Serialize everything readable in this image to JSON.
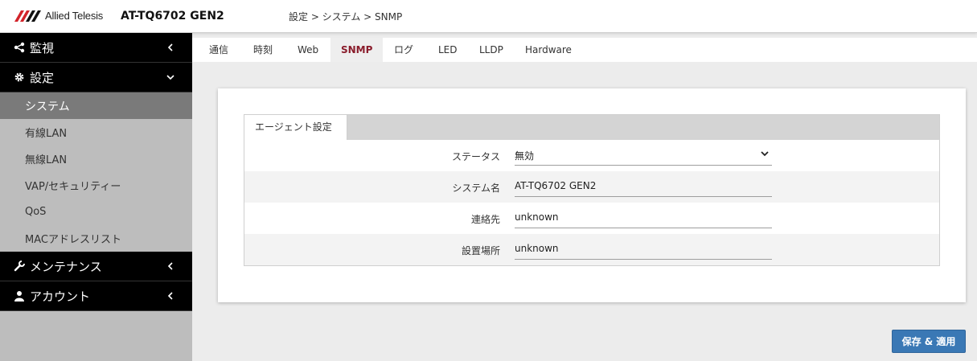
{
  "header": {
    "logo_text": "Allied Telesis",
    "model": "AT-TQ6702 GEN2",
    "breadcrumb": "設定 > システム > SNMP"
  },
  "sidebar": {
    "sections": [
      {
        "label": "監視",
        "icon": "share-icon"
      },
      {
        "label": "設定",
        "icon": "gear-icon",
        "expanded": true
      },
      {
        "label": "メンテナンス",
        "icon": "wrench-icon"
      },
      {
        "label": "アカウント",
        "icon": "user-icon"
      }
    ],
    "settings_items": [
      "システム",
      "有線LAN",
      "無線LAN",
      "VAP/セキュリティー",
      "QoS",
      "MACアドレスリスト"
    ],
    "active_item": "システム"
  },
  "tabs": [
    "通信",
    "時刻",
    "Web",
    "SNMP",
    "ログ",
    "LED",
    "LLDP",
    "Hardware"
  ],
  "active_tab": "SNMP",
  "form": {
    "section_title": "エージェント設定",
    "status_label": "ステータス",
    "status_value": "無効",
    "system_name_label": "システム名",
    "system_name_value": "AT-TQ6702 GEN2",
    "contact_label": "連絡先",
    "contact_value": "unknown",
    "location_label": "設置場所",
    "location_value": "unknown"
  },
  "save_button": "保存 & 適用",
  "colors": {
    "accent_tab": "#8a1c2b",
    "button": "#3a78b5",
    "sidebar_active": "#7a7a7a",
    "logo_red": "#d2232a"
  }
}
